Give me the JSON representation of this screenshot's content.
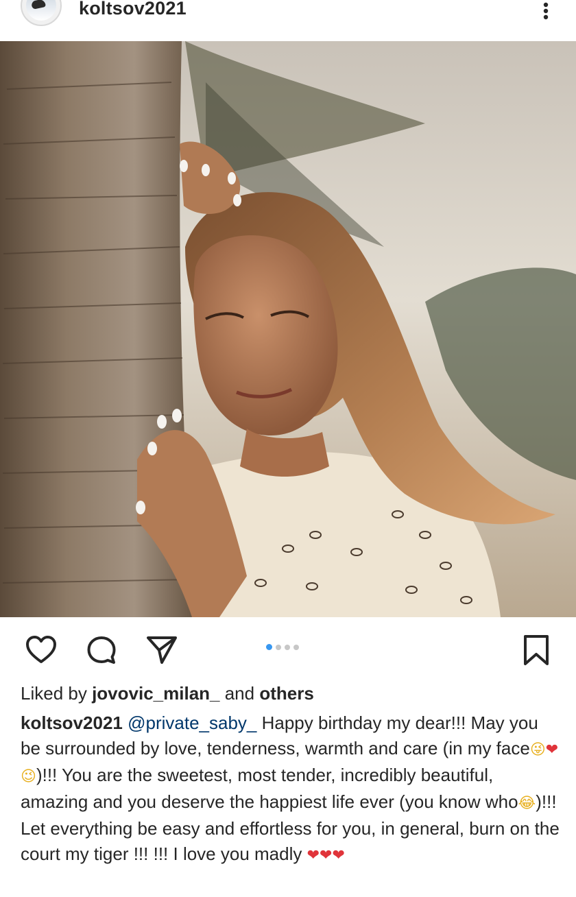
{
  "post": {
    "username": "koltsov2021",
    "liked_by_prefix": "Liked by ",
    "liked_by_user": "jovovic_milan_",
    "liked_by_middle": " and ",
    "liked_by_others": "others",
    "caption_user": "koltsov2021",
    "caption_mention": "@private_saby_",
    "caption_part1": " Happy birthday my dear!!! May you be surrounded by love, tenderness, warmth and care (in my face",
    "caption_emoji1": "😜",
    "caption_emoji2": "❤",
    "caption_emoji3": "😉",
    "caption_part2": ")!!! You are the sweetest, most tender, incredibly beautiful, amazing and you deserve the happiest life ever (you know who",
    "caption_emoji4": "😂",
    "caption_part3": ")!!! Let everything be easy and effortless for you, in general, burn on the court my tiger !!! !!! I love you madly ",
    "caption_end_hearts": "❤❤❤"
  },
  "carousel": {
    "total": 4,
    "active_index": 0
  },
  "icons": {
    "more": "more-vertical-icon",
    "like": "heart-icon",
    "comment": "comment-icon",
    "share": "send-icon",
    "save": "bookmark-icon"
  },
  "colors": {
    "accent": "#3897f0",
    "text": "#262626",
    "mention": "#00376b",
    "heart": "#e0343a"
  }
}
